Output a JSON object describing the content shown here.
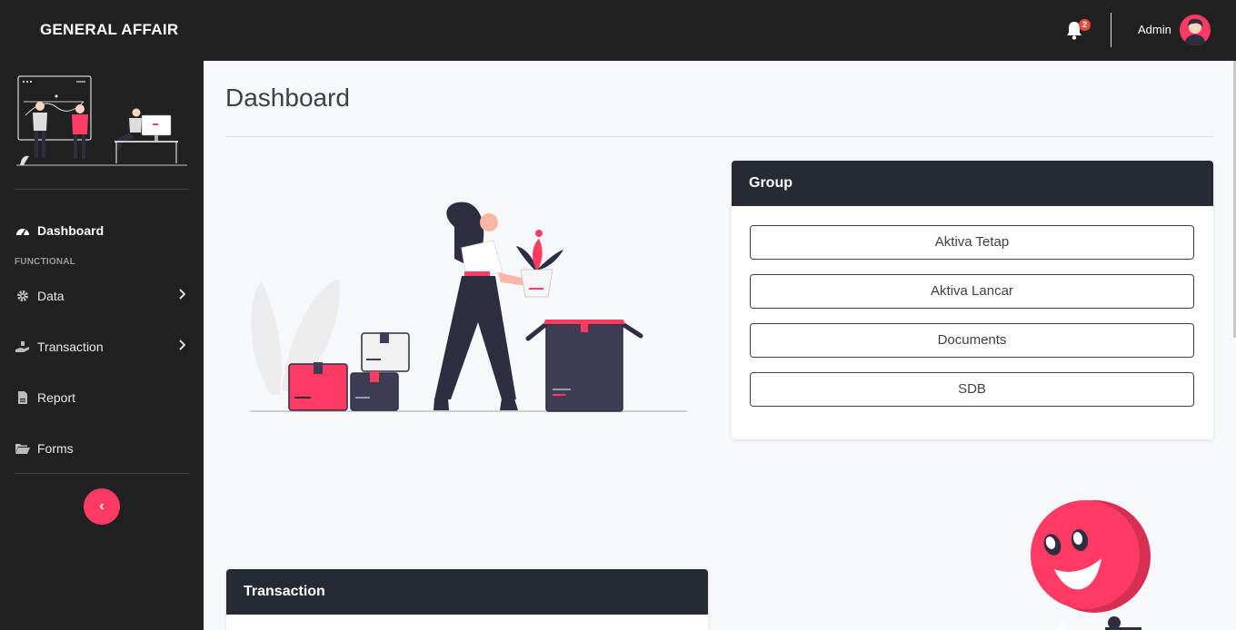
{
  "app": {
    "brand": "GENERAL AFFAIR"
  },
  "topbar": {
    "notification_count": "2",
    "user_name": "Admin"
  },
  "sidebar": {
    "heading_functional": "FUNCTIONAL",
    "items": [
      {
        "label": "Dashboard",
        "icon": "dashboard-gauge-icon",
        "active": true
      },
      {
        "label": "Data",
        "icon": "gear-icon",
        "has_submenu": true
      },
      {
        "label": "Transaction",
        "icon": "hand-money-icon",
        "has_submenu": true
      },
      {
        "label": "Report",
        "icon": "file-report-icon"
      },
      {
        "label": "Forms",
        "icon": "folder-open-icon"
      }
    ],
    "collapse_symbol": "‹"
  },
  "main": {
    "title": "Dashboard",
    "group_card": {
      "title": "Group",
      "buttons": [
        "Aktiva Tetap",
        "Aktiva Lancar",
        "Documents",
        "SDB"
      ]
    },
    "transaction_card": {
      "title": "Transaction"
    }
  },
  "colors": {
    "accent": "#ff3a63",
    "dark": "#212121",
    "card_header": "#252a33",
    "page_bg": "#f7f8fb"
  }
}
